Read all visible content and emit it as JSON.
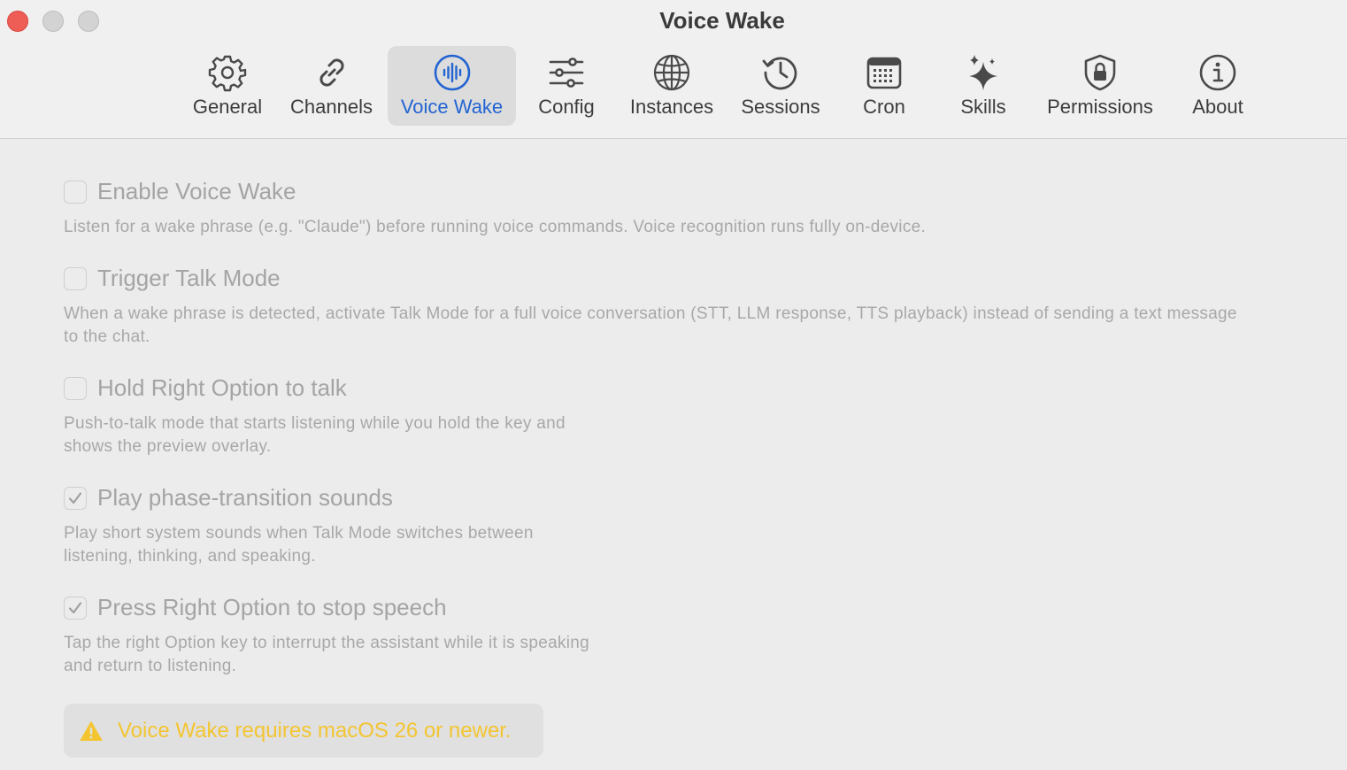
{
  "window": {
    "title": "Voice Wake"
  },
  "tabs": [
    {
      "label": "General",
      "icon": "gear-icon"
    },
    {
      "label": "Channels",
      "icon": "link-icon"
    },
    {
      "label": "Voice Wake",
      "icon": "waveform-icon",
      "selected": true
    },
    {
      "label": "Config",
      "icon": "sliders-icon"
    },
    {
      "label": "Instances",
      "icon": "globe-icon"
    },
    {
      "label": "Sessions",
      "icon": "history-clock-icon"
    },
    {
      "label": "Cron",
      "icon": "calendar-icon"
    },
    {
      "label": "Skills",
      "icon": "sparkles-icon"
    },
    {
      "label": "Permissions",
      "icon": "lock-shield-icon"
    },
    {
      "label": "About",
      "icon": "info-icon"
    }
  ],
  "options": [
    {
      "label": "Enable Voice Wake",
      "checked": false,
      "description": "Listen for a wake phrase (e.g. \"Claude\") before running voice commands. Voice recognition runs fully on-device."
    },
    {
      "label": "Trigger Talk Mode",
      "checked": false,
      "description": "When a wake phrase is detected, activate Talk Mode for a full voice conversation (STT, LLM response, TTS playback) instead of sending a text message to the chat."
    },
    {
      "label": "Hold Right Option to talk",
      "checked": false,
      "description": "Push-to-talk mode that starts listening while you hold the key and shows the preview overlay."
    },
    {
      "label": "Play phase-transition sounds",
      "checked": true,
      "description": "Play short system sounds when Talk Mode switches between listening, thinking, and speaking."
    },
    {
      "label": "Press Right Option to stop speech",
      "checked": true,
      "description": "Tap the right Option key to interrupt the assistant while it is speaking and return to listening."
    }
  ],
  "warning": {
    "text": "Voice Wake requires macOS 26 or newer.",
    "icon": "warning-triangle-icon",
    "color": "#f3c531"
  },
  "colors": {
    "accent": "#2364d2",
    "close": "#ee5e57"
  }
}
